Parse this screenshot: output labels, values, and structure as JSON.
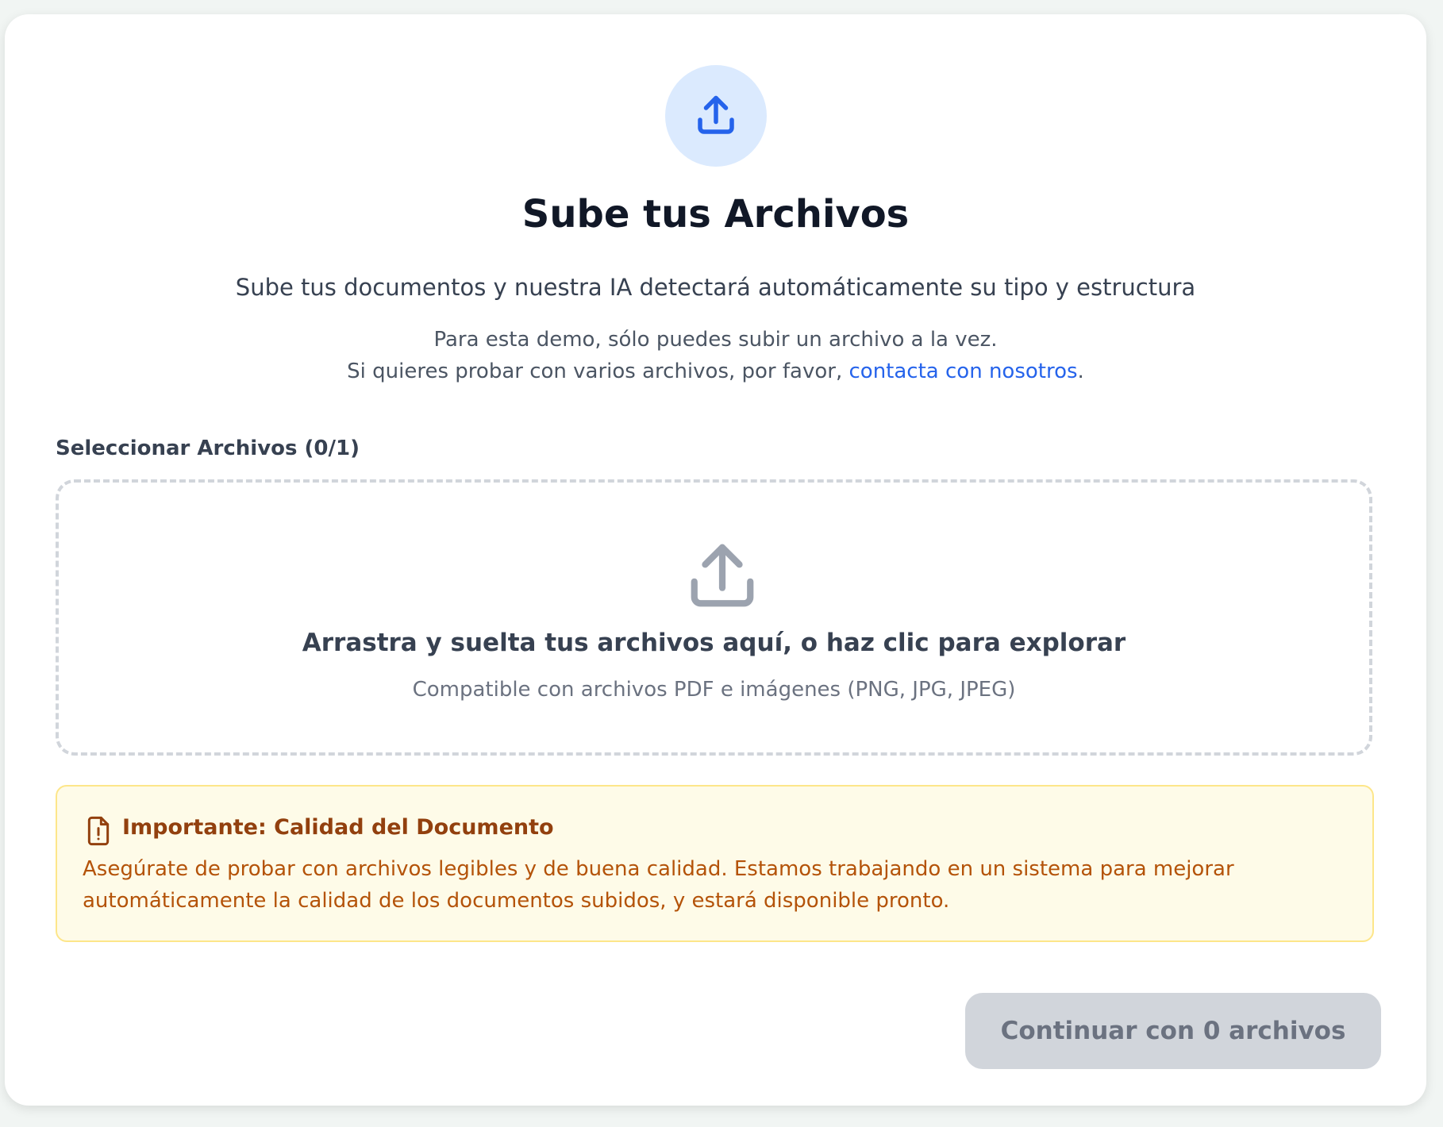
{
  "header": {
    "icon": "upload-icon",
    "title": "Sube tus Archivos",
    "subtitle": "Sube tus documentos y nuestra IA detectará automáticamente su tipo y estructura",
    "note_line1": "Para esta demo, sólo puedes subir un archivo a la vez.",
    "note_line2_prefix": "Si quieres probar con varios archivos, por favor, ",
    "note_link": "contacta con nosotros",
    "note_line2_suffix": "."
  },
  "selector": {
    "label": "Seleccionar Archivos (0/1)"
  },
  "dropzone": {
    "icon": "upload-icon",
    "title": "Arrastra y suelta tus archivos aquí, o haz clic para explorar",
    "subtitle": "Compatible con archivos PDF e imágenes (PNG, JPG, JPEG)"
  },
  "warning": {
    "icon": "file-alert-icon",
    "title": "Importante: Calidad del Documento",
    "text": "Asegúrate de probar con archivos legibles y de buena calidad. Estamos trabajando en un sistema para mejorar automáticamente la calidad de los documentos subidos, y estará disponible pronto."
  },
  "actions": {
    "continue_label": "Continuar con 0 archivos"
  },
  "colors": {
    "accent": "#2563eb",
    "icon_bg": "#dbeafe",
    "warning_bg": "#fefbe8",
    "warning_border": "#fde68a",
    "warning_title": "#92400e",
    "warning_text": "#b45309",
    "button_disabled_bg": "#d1d5db"
  }
}
